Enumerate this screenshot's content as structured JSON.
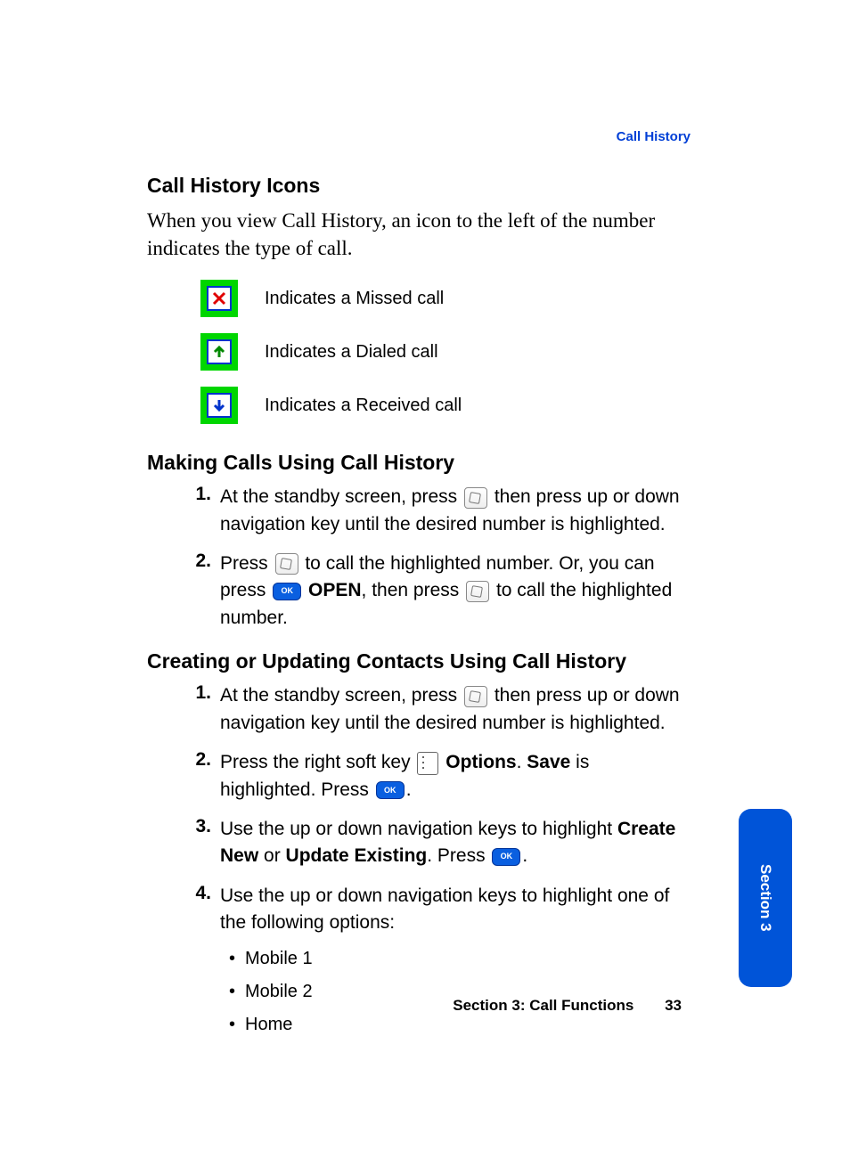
{
  "header": {
    "section_link": "Call History"
  },
  "h1": "Call History Icons",
  "intro": "When you view Call History, an icon to the left of the number indicates the type of call.",
  "icons": {
    "missed": "Indicates a Missed call",
    "dialed": "Indicates a Dialed call",
    "received": "Indicates a Received call"
  },
  "h2": "Making Calls Using Call History",
  "making": {
    "s1_a": "At the standby screen, press ",
    "s1_b": " then press up or down navigation key until the desired number is highlighted.",
    "s2_a": "Press ",
    "s2_b": " to call the highlighted number. Or, you can press ",
    "s2_open": "OPEN",
    "s2_c": ", then press ",
    "s2_d": " to call the highlighted number."
  },
  "h3": "Creating or Updating Contacts Using Call History",
  "creating": {
    "s1_a": "At the standby screen, press ",
    "s1_b": " then press up or down navigation key until the desired number is highlighted.",
    "s2_a": "Press the right soft key ",
    "s2_options": "Options",
    "s2_b": ". ",
    "s2_save": "Save",
    "s2_c": " is highlighted. Press ",
    "s2_d": ".",
    "s3_a": "Use the up or down navigation keys to highlight ",
    "s3_create": "Create New",
    "s3_or": " or ",
    "s3_update": "Update Existing",
    "s3_b": ". Press ",
    "s3_c": ".",
    "s4": "Use the up or down navigation keys to highlight one of the following options:",
    "opts": [
      "Mobile 1",
      "Mobile 2",
      "Home"
    ]
  },
  "footer": {
    "section": "Section 3: Call Functions",
    "page": "33"
  },
  "sidetab": "Section 3",
  "nums": {
    "n1": "1.",
    "n2": "2.",
    "n3": "3.",
    "n4": "4."
  }
}
